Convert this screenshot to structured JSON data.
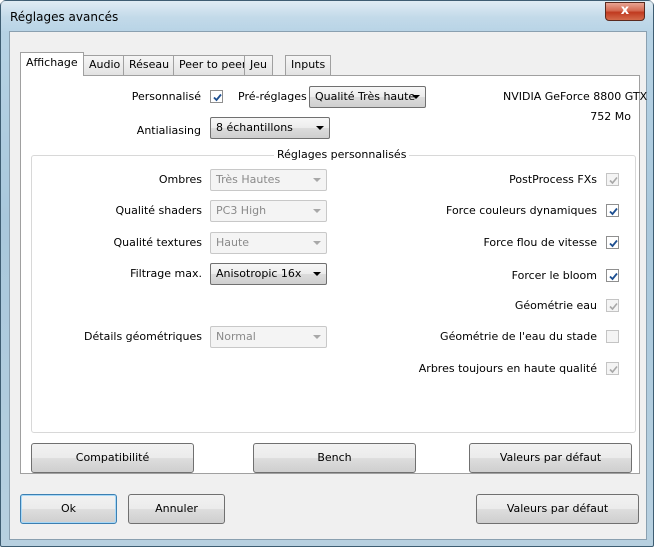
{
  "window": {
    "title": "Réglages avancés",
    "close_label": "x"
  },
  "tabs": [
    "Affichage",
    "Audio",
    "Réseau",
    "Peer to peer",
    "Jeu",
    "Inputs"
  ],
  "display": {
    "personnalise_label": "Personnalisé",
    "personnalise_checked": true,
    "presets_label": "Pré-réglages",
    "presets_value": "Qualité Très haute",
    "antialiasing_label": "Antialiasing",
    "antialiasing_value": "8 échantillons",
    "gpu_name": "NVIDIA GeForce 8800 GTX",
    "gpu_memory": "752 Mo"
  },
  "custom": {
    "title": "Réglages personnalisés",
    "left": [
      {
        "label": "Ombres",
        "value": "Très Hautes",
        "enabled": false
      },
      {
        "label": "Qualité shaders",
        "value": "PC3 High",
        "enabled": false
      },
      {
        "label": "Qualité textures",
        "value": "Haute",
        "enabled": false
      },
      {
        "label": "Filtrage max.",
        "value": "Anisotropic 16x",
        "enabled": true
      },
      {
        "label": "Détails géométriques",
        "value": "Normal",
        "enabled": false
      }
    ],
    "right": [
      {
        "label": "PostProcess FXs",
        "checked": true,
        "enabled": false
      },
      {
        "label": "Force couleurs dynamiques",
        "checked": true,
        "enabled": true
      },
      {
        "label": "Force flou de vitesse",
        "checked": true,
        "enabled": true
      },
      {
        "label": "Forcer le bloom",
        "checked": true,
        "enabled": true
      },
      {
        "label": "Géométrie eau",
        "checked": true,
        "enabled": false
      },
      {
        "label": "Géométrie de l'eau du stade",
        "checked": false,
        "enabled": false
      },
      {
        "label": "Arbres toujours en haute qualité",
        "checked": true,
        "enabled": false
      }
    ]
  },
  "panel_buttons": {
    "compat": "Compatibilité",
    "bench": "Bench",
    "defaults": "Valeurs par défaut"
  },
  "footer": {
    "ok": "Ok",
    "cancel": "Annuler",
    "defaults": "Valeurs par défaut"
  }
}
